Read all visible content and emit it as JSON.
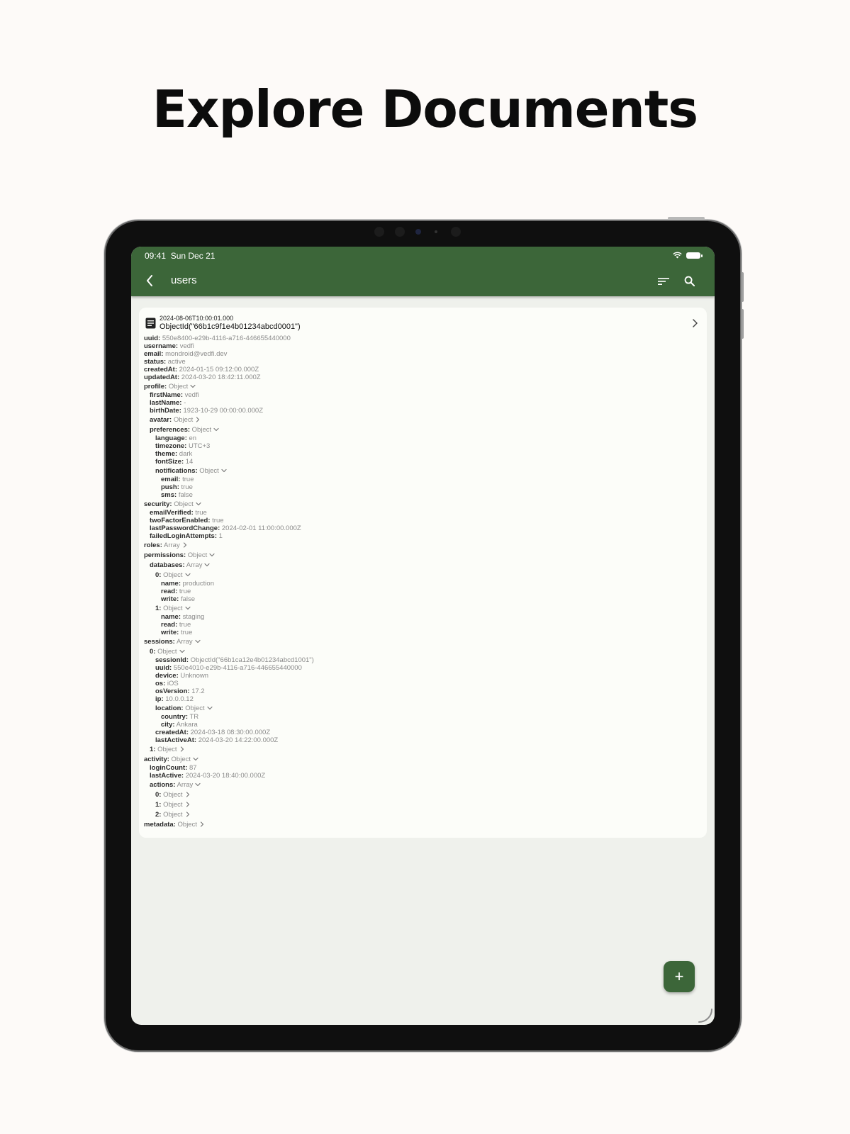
{
  "headline": "Explore Documents",
  "status_bar": {
    "time": "09:41",
    "date": "Sun Dec 21"
  },
  "app_bar": {
    "title": "users"
  },
  "document": {
    "timestamp": "2024-08-06T10:00:01.000",
    "object_id": "ObjectId(\"66b1c9f1e4b01234abcd0001\")"
  },
  "fields": [
    {
      "depth": 0,
      "key": "uuid:",
      "value": "550e8400-e29b-4116-a716-446655440000",
      "toggle": "none"
    },
    {
      "depth": 0,
      "key": "username:",
      "value": "vedfi",
      "toggle": "none"
    },
    {
      "depth": 0,
      "key": "email:",
      "value": "mondroid@vedfi.dev",
      "toggle": "none"
    },
    {
      "depth": 0,
      "key": "status:",
      "value": "active",
      "toggle": "none"
    },
    {
      "depth": 0,
      "key": "createdAt:",
      "value": "2024-01-15 09:12:00.000Z",
      "toggle": "none"
    },
    {
      "depth": 0,
      "key": "updatedAt:",
      "value": "2024-03-20 18:42:11.000Z",
      "toggle": "none"
    },
    {
      "depth": 0,
      "key": "profile:",
      "value": "Object",
      "toggle": "expanded"
    },
    {
      "depth": 1,
      "key": "firstName:",
      "value": "vedfi",
      "toggle": "none"
    },
    {
      "depth": 1,
      "key": "lastName:",
      "value": "-",
      "toggle": "none"
    },
    {
      "depth": 1,
      "key": "birthDate:",
      "value": "1923-10-29 00:00:00.000Z",
      "toggle": "none"
    },
    {
      "depth": 1,
      "key": "avatar:",
      "value": "Object",
      "toggle": "collapsed"
    },
    {
      "depth": 1,
      "key": "preferences:",
      "value": "Object",
      "toggle": "expanded"
    },
    {
      "depth": 2,
      "key": "language:",
      "value": "en",
      "toggle": "none"
    },
    {
      "depth": 2,
      "key": "timezone:",
      "value": "UTC+3",
      "toggle": "none"
    },
    {
      "depth": 2,
      "key": "theme:",
      "value": "dark",
      "toggle": "none"
    },
    {
      "depth": 2,
      "key": "fontSize:",
      "value": "14",
      "toggle": "none"
    },
    {
      "depth": 2,
      "key": "notifications:",
      "value": "Object",
      "toggle": "expanded"
    },
    {
      "depth": 3,
      "key": "email:",
      "value": "true",
      "toggle": "none"
    },
    {
      "depth": 3,
      "key": "push:",
      "value": "true",
      "toggle": "none"
    },
    {
      "depth": 3,
      "key": "sms:",
      "value": "false",
      "toggle": "none"
    },
    {
      "depth": 0,
      "key": "security:",
      "value": "Object",
      "toggle": "expanded"
    },
    {
      "depth": 1,
      "key": "emailVerified:",
      "value": "true",
      "toggle": "none"
    },
    {
      "depth": 1,
      "key": "twoFactorEnabled:",
      "value": "true",
      "toggle": "none"
    },
    {
      "depth": 1,
      "key": "lastPasswordChange:",
      "value": "2024-02-01 11:00:00.000Z",
      "toggle": "none"
    },
    {
      "depth": 1,
      "key": "failedLoginAttempts:",
      "value": "1",
      "toggle": "none"
    },
    {
      "depth": 0,
      "key": "roles:",
      "value": "Array",
      "toggle": "collapsed"
    },
    {
      "depth": 0,
      "key": "permissions:",
      "value": "Object",
      "toggle": "expanded"
    },
    {
      "depth": 1,
      "key": "databases:",
      "value": "Array",
      "toggle": "expanded"
    },
    {
      "depth": 2,
      "key": "0:",
      "value": "Object",
      "toggle": "expanded"
    },
    {
      "depth": 3,
      "key": "name:",
      "value": "production",
      "toggle": "none"
    },
    {
      "depth": 3,
      "key": "read:",
      "value": "true",
      "toggle": "none"
    },
    {
      "depth": 3,
      "key": "write:",
      "value": "false",
      "toggle": "none"
    },
    {
      "depth": 2,
      "key": "1:",
      "value": "Object",
      "toggle": "expanded"
    },
    {
      "depth": 3,
      "key": "name:",
      "value": "staging",
      "toggle": "none"
    },
    {
      "depth": 3,
      "key": "read:",
      "value": "true",
      "toggle": "none"
    },
    {
      "depth": 3,
      "key": "write:",
      "value": "true",
      "toggle": "none"
    },
    {
      "depth": 0,
      "key": "sessions:",
      "value": "Array",
      "toggle": "expanded"
    },
    {
      "depth": 1,
      "key": "0:",
      "value": "Object",
      "toggle": "expanded"
    },
    {
      "depth": 2,
      "key": "sessionId:",
      "value": "ObjectId(\"66b1ca12e4b01234abcd1001\")",
      "toggle": "none"
    },
    {
      "depth": 2,
      "key": "uuid:",
      "value": "550e4010-e29b-4116-a716-446655440000",
      "toggle": "none"
    },
    {
      "depth": 2,
      "key": "device:",
      "value": "Unknown",
      "toggle": "none"
    },
    {
      "depth": 2,
      "key": "os:",
      "value": "iOS",
      "toggle": "none"
    },
    {
      "depth": 2,
      "key": "osVersion:",
      "value": "17.2",
      "toggle": "none"
    },
    {
      "depth": 2,
      "key": "ip:",
      "value": "10.0.0.12",
      "toggle": "none"
    },
    {
      "depth": 2,
      "key": "location:",
      "value": "Object",
      "toggle": "expanded"
    },
    {
      "depth": 3,
      "key": "country:",
      "value": "TR",
      "toggle": "none"
    },
    {
      "depth": 3,
      "key": "city:",
      "value": "Ankara",
      "toggle": "none"
    },
    {
      "depth": 2,
      "key": "createdAt:",
      "value": "2024-03-18 08:30:00.000Z",
      "toggle": "none"
    },
    {
      "depth": 2,
      "key": "lastActiveAt:",
      "value": "2024-03-20 14:22:00.000Z",
      "toggle": "none"
    },
    {
      "depth": 1,
      "key": "1:",
      "value": "Object",
      "toggle": "collapsed"
    },
    {
      "depth": 0,
      "key": "activity:",
      "value": "Object",
      "toggle": "expanded"
    },
    {
      "depth": 1,
      "key": "loginCount:",
      "value": "87",
      "toggle": "none"
    },
    {
      "depth": 1,
      "key": "lastActive:",
      "value": "2024-03-20 18:40:00.000Z",
      "toggle": "none"
    },
    {
      "depth": 1,
      "key": "actions:",
      "value": "Array",
      "toggle": "expanded"
    },
    {
      "depth": 2,
      "key": "0:",
      "value": "Object",
      "toggle": "collapsed"
    },
    {
      "depth": 2,
      "key": "1:",
      "value": "Object",
      "toggle": "collapsed"
    },
    {
      "depth": 2,
      "key": "2:",
      "value": "Object",
      "toggle": "collapsed"
    },
    {
      "depth": 0,
      "key": "metadata:",
      "value": "Object",
      "toggle": "collapsed"
    }
  ],
  "fab": {
    "label": "+"
  },
  "colors": {
    "accent": "#3c6639",
    "page_background": "#fdfaf8",
    "screen_background": "#eff1ec",
    "card_background": "#fcfdf9"
  },
  "icons": {
    "back": "chevron-left-icon",
    "sort": "sort-icon",
    "search": "search-icon",
    "document": "document-icon",
    "open": "chevron-right-icon",
    "expanded": "chevron-down-icon",
    "collapsed": "chevron-right-icon",
    "wifi": "wifi-icon",
    "battery": "battery-icon"
  }
}
